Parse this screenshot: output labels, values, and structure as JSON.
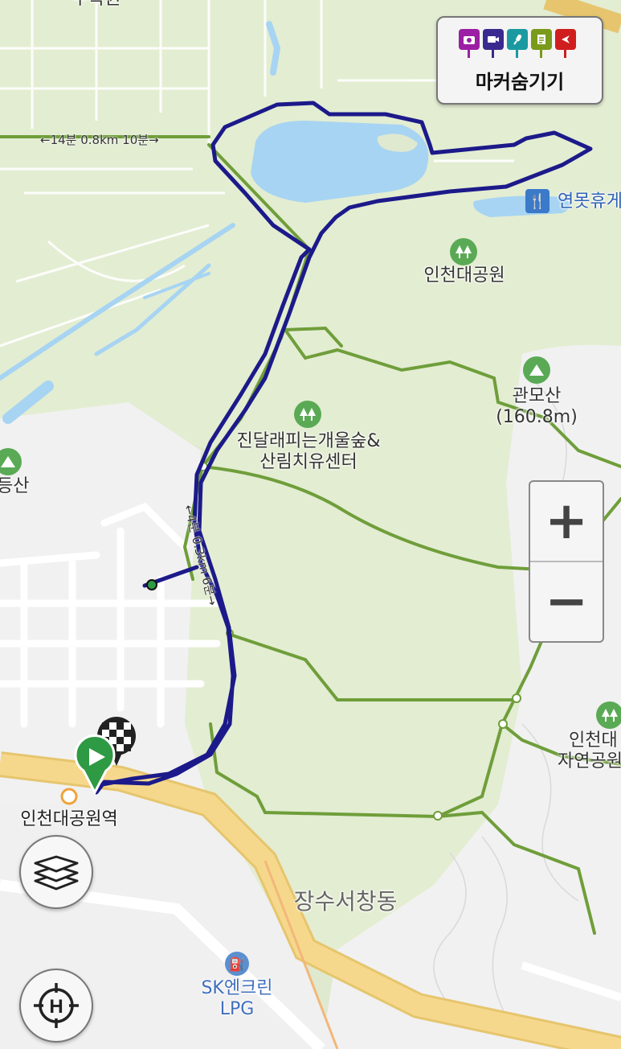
{
  "marker_panel": {
    "toggle_label": "마커숨기기",
    "icons": [
      {
        "name": "camera-marker-icon",
        "color": "#9b1fa3"
      },
      {
        "name": "video-marker-icon",
        "color": "#3a2a8f"
      },
      {
        "name": "audio-marker-icon",
        "color": "#1a9aa0"
      },
      {
        "name": "memo-marker-icon",
        "color": "#7a9a1a"
      },
      {
        "name": "flag-marker-icon",
        "color": "#d01e1e"
      }
    ]
  },
  "zoom": {
    "in_label": "+",
    "out_label": "−"
  },
  "map_labels": {
    "top_cut": "수목원",
    "restarea": "연못휴게",
    "park": "인천대공원",
    "mountain": "관모산",
    "mountain_height": "(160.8m)",
    "forest_line1": "진달래피는개울숲&",
    "forest_line2": "산림치유센터",
    "left_mountain": "등산",
    "nature_park_line1": "인천대",
    "nature_park_line2": "자연공원",
    "station": "인천대공원역",
    "district": "장수서창동",
    "gas_line1": "SK엔크린",
    "gas_line2": "LPG",
    "trail_top": "←14분 0.8km 10분→",
    "trail_mid": "←4분 0.3km 6분→"
  },
  "colors": {
    "track": "#1c1a8a",
    "trail": "#6f9e3a",
    "park_bg": "#dfe9cf",
    "urban_bg": "#f1f1f1",
    "water": "#a7d4f2",
    "road_major": "#f6d88c"
  }
}
